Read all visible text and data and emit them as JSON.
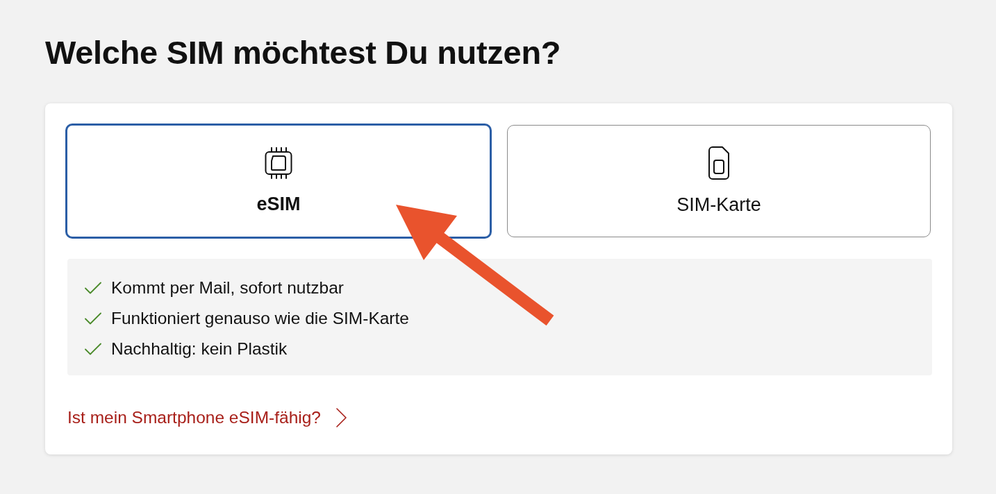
{
  "heading": "Welche SIM möchtest Du nutzen?",
  "options": [
    {
      "kind": "esim",
      "label": "eSIM",
      "selected": true
    },
    {
      "kind": "sim-card",
      "label": "SIM-Karte",
      "selected": false
    }
  ],
  "features": [
    "Kommt per Mail, sofort nutzbar",
    "Funktioniert genauso wie die SIM-Karte",
    "Nachhaltig: kein Plastik"
  ],
  "link": {
    "text": "Ist mein Smartphone eSIM-fähig?"
  },
  "annotations": [
    {
      "kind": "arrow"
    }
  ]
}
